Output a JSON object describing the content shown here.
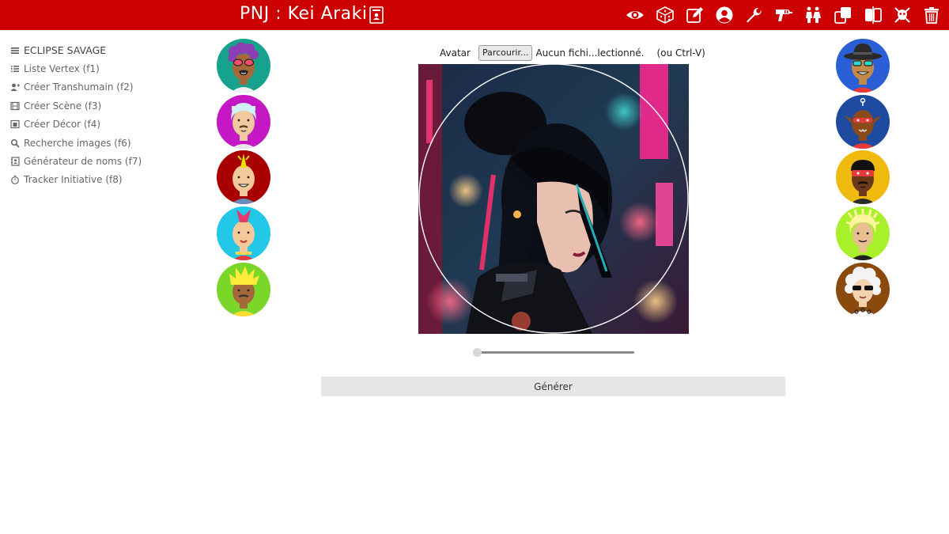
{
  "header": {
    "title": "PNJ : Kei Araki",
    "title_icon": "character-card-icon",
    "tools": [
      {
        "name": "eye-icon"
      },
      {
        "name": "dice-icon"
      },
      {
        "name": "edit-icon"
      },
      {
        "name": "user-circle-icon"
      },
      {
        "name": "wrench-icon"
      },
      {
        "name": "raygun-icon"
      },
      {
        "name": "people-icon"
      },
      {
        "name": "duplicate-icon"
      },
      {
        "name": "split-icon"
      },
      {
        "name": "skull-crossbones-icon"
      },
      {
        "name": "trash-icon"
      }
    ],
    "bg_color": "#cc0000"
  },
  "sidebar": {
    "items": [
      {
        "label": "ECLIPSE SAVAGE",
        "icon": "menu-icon"
      },
      {
        "label": "Liste Vertex (f1)",
        "icon": "list-icon"
      },
      {
        "label": "Créer Transhumain (f2)",
        "icon": "user-plus-icon"
      },
      {
        "label": "Créer Scène (f3)",
        "icon": "film-icon"
      },
      {
        "label": "Créer Décor (f4)",
        "icon": "window-icon"
      },
      {
        "label": "Recherche images (f6)",
        "icon": "search-icon"
      },
      {
        "label": "Générateur de noms (f7)",
        "icon": "address-book-icon"
      },
      {
        "label": "Tracker Initiative (f8)",
        "icon": "stopwatch-icon"
      }
    ]
  },
  "avatars_left": [
    {
      "name": "avatar-purple-hair",
      "bg": "#17a28e"
    },
    {
      "name": "avatar-white-hair",
      "bg": "#c418c4"
    },
    {
      "name": "avatar-mohawk-yellow",
      "bg": "#a80000"
    },
    {
      "name": "avatar-red-mohawk",
      "bg": "#23c7e8"
    },
    {
      "name": "avatar-spiky-blond",
      "bg": "#7bd62a"
    }
  ],
  "avatars_right": [
    {
      "name": "avatar-fedora",
      "bg": "#2a5fd6"
    },
    {
      "name": "avatar-alien",
      "bg": "#1e4aa0"
    },
    {
      "name": "avatar-red-visor",
      "bg": "#f0b90e"
    },
    {
      "name": "avatar-dreadlocks",
      "bg": "#a8f02a"
    },
    {
      "name": "avatar-white-afro",
      "bg": "#8a4a0e"
    }
  ],
  "upload": {
    "label": "Avatar",
    "browse": "Parcourir...",
    "file_name": "Aucun fichi...lectionné.",
    "paste_hint": "(ou Ctrl-V)"
  },
  "slider": {
    "value": 0
  },
  "generate_label": "Générer"
}
